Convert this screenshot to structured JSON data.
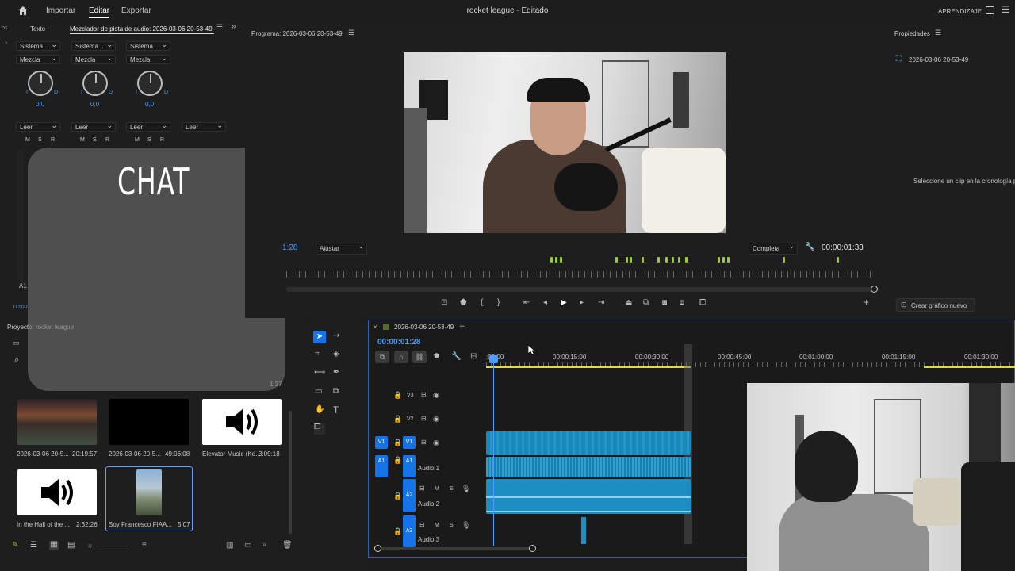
{
  "topbar": {
    "home_icon": "home-icon",
    "menu": [
      "Importar",
      "Editar",
      "Exportar"
    ],
    "title": "rocket league - Editado",
    "learn": "APRENDIZAJE"
  },
  "mixer": {
    "tabs": [
      "Texto",
      "Mezclador de pista de audio: 2026-03-06 20-53-49"
    ],
    "sistema": [
      "Sistema...",
      "Sistema...",
      "Sistema..."
    ],
    "mezcla": [
      "Mezcla",
      "Mezcla",
      "Mezcla"
    ],
    "values": [
      "0,0",
      "0,0",
      "0,0"
    ],
    "leer": [
      "Leer",
      "Leer",
      "Leer",
      "Leer"
    ],
    "msr": [
      "M",
      "S",
      "R"
    ],
    "time": "00:00"
  },
  "overlay": {
    "chat": "CHAT"
  },
  "program": {
    "title": "Programa: 2026-03-06 20-53-49",
    "time_left": "00:00:01:28",
    "time_left_visible": "1:28",
    "ajustar": "Ajustar",
    "completa": "Completa",
    "time_right": "00:00:01:33"
  },
  "properties": {
    "title": "Propiedades",
    "sequence": "2026-03-06 20-53-49",
    "hint": "Seleccione un clip en la cronología p",
    "create_button": "Crear gráfico nuevo"
  },
  "project": {
    "tab": "Proyecto: rocket league",
    "items": [
      {
        "name": "2026-03-06 20-5...",
        "duration": "20:19:57"
      },
      {
        "name": "2026-03-06 20-5...",
        "duration": "49:06:08"
      },
      {
        "name": "Elevator Music (Ke...",
        "duration": "3:09:18"
      },
      {
        "name": "In the Hall of the ...",
        "duration": "2:32:26"
      },
      {
        "name": "Soy Francesco FIAA...",
        "duration": "5:07"
      }
    ],
    "partial_duration": "1:37"
  },
  "timeline": {
    "sequence": "2026-03-06 20-53-49",
    "timecode": "00:00:01:28",
    "ruler": [
      ":00:00",
      "00:00:15:00",
      "00:00:30:00",
      "00:00:45:00",
      "00:01:00:00",
      "00:01:15:00",
      "00:01:30:00"
    ],
    "tracks": [
      {
        "id": "V3"
      },
      {
        "id": "V2"
      },
      {
        "id": "V1"
      },
      {
        "id": "A1",
        "name": "Audio 1"
      },
      {
        "id": "A2",
        "name": "Audio 2"
      },
      {
        "id": "A3",
        "name": "Audio 3"
      }
    ],
    "track_letters": [
      "M",
      "S"
    ]
  },
  "colors": {
    "accent": "#4a9eff",
    "clip": "#1f8fc4",
    "marker": "#9acd32",
    "playhead": "#1473e6"
  }
}
